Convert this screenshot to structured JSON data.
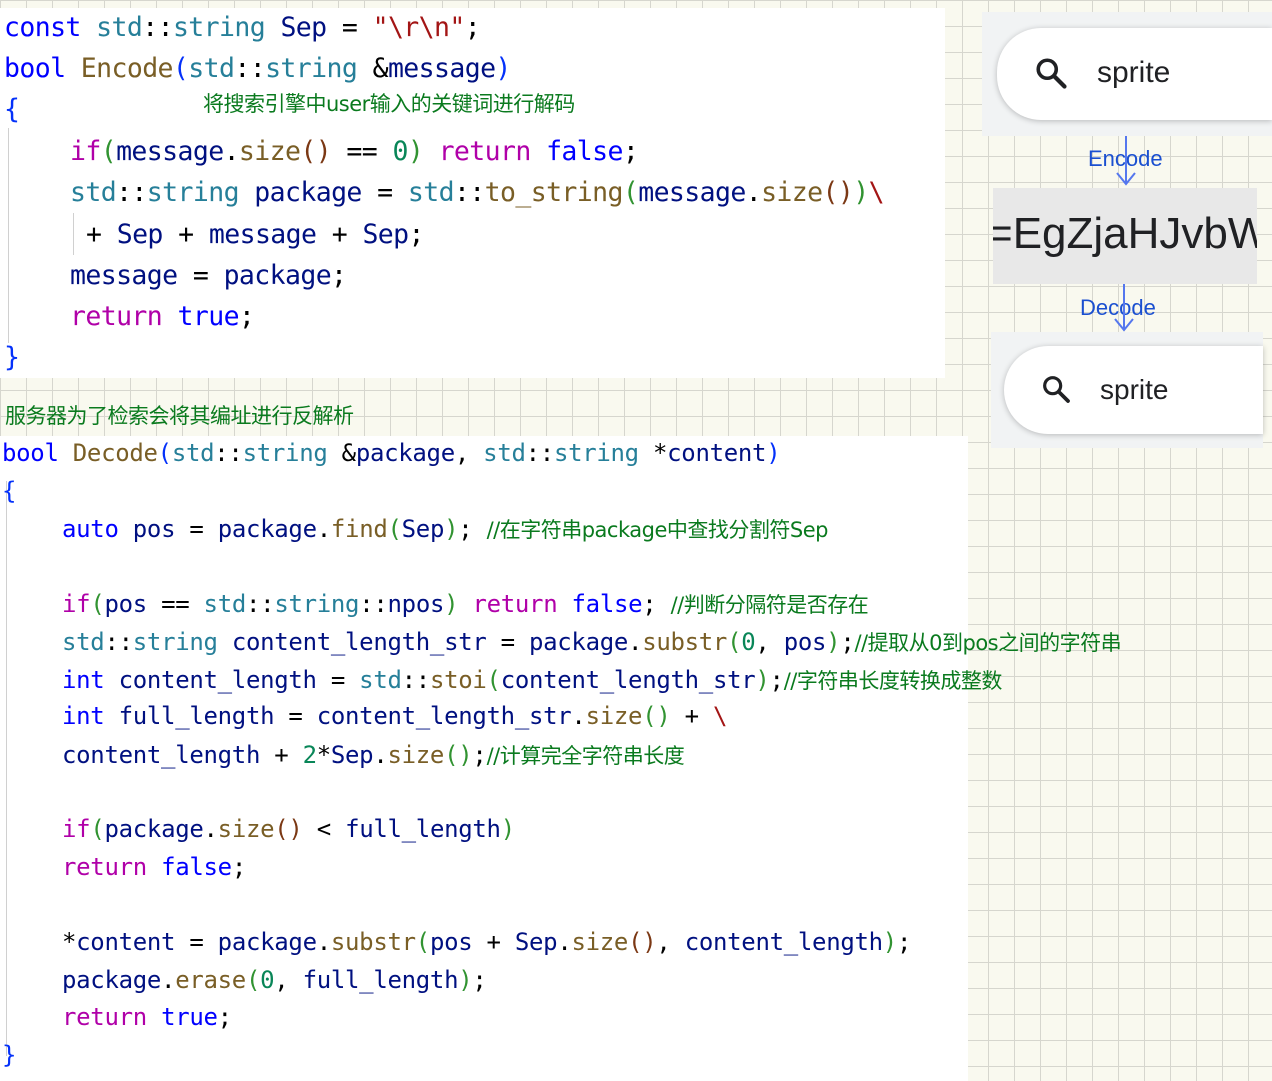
{
  "encode_panel": {
    "annotation": "将搜索引擎中user输入的关键词进行解码",
    "lines": [
      "const std::string Sep = \"\\r\\n\";",
      "bool Encode(std::string &message)",
      "{",
      "    if(message.size() == 0) return false;",
      "    std::string package = std::to_string(message.size())\\",
      "     + Sep + message + Sep;",
      "    message = package;",
      "    return true;",
      "}"
    ]
  },
  "decode_annotation": "服务器为了检索会将其编址进行反解析",
  "decode_panel": {
    "lines": [
      "bool Decode(std::string &package, std::string *content)",
      "{",
      "    auto pos = package.find(Sep);",
      "    if(pos == std::string::npos) return false;",
      "    std::string content_length_str = package.substr(0, pos);",
      "    int content_length = std::stoi(content_length_str);",
      "    int full_length = content_length_str.size() + \\",
      "    content_length + 2*Sep.size();",
      "    if(package.size() < full_length)",
      "    return false;",
      "    *content = package.substr(pos + Sep.size(), content_length);",
      "    package.erase(0, full_length);",
      "    return true;",
      "}"
    ],
    "comments": {
      "find": "//在字符串package中查找分割符Sep",
      "npos": "//判断分隔符是否存在",
      "substr": "//提取从0到pos之间的字符串",
      "stoi": "//字符串长度转换成整数",
      "full": "//计算完全字符串长度"
    }
  },
  "diagram": {
    "search_top": {
      "query": "sprite",
      "icon": "search-icon"
    },
    "encode_label": "Encode",
    "encoded_value": "=EgZjaHJvbW",
    "decode_label": "Decode",
    "search_bottom": {
      "query": "sprite",
      "icon": "search-icon"
    }
  },
  "colors": {
    "keyword": "#0000ff",
    "control": "#b000a8",
    "type": "#267f99",
    "function": "#795e26",
    "variable": "#001080",
    "string": "#a31515",
    "number": "#098658",
    "comment": "#0a7a1e",
    "arrow": "#5577ee"
  }
}
